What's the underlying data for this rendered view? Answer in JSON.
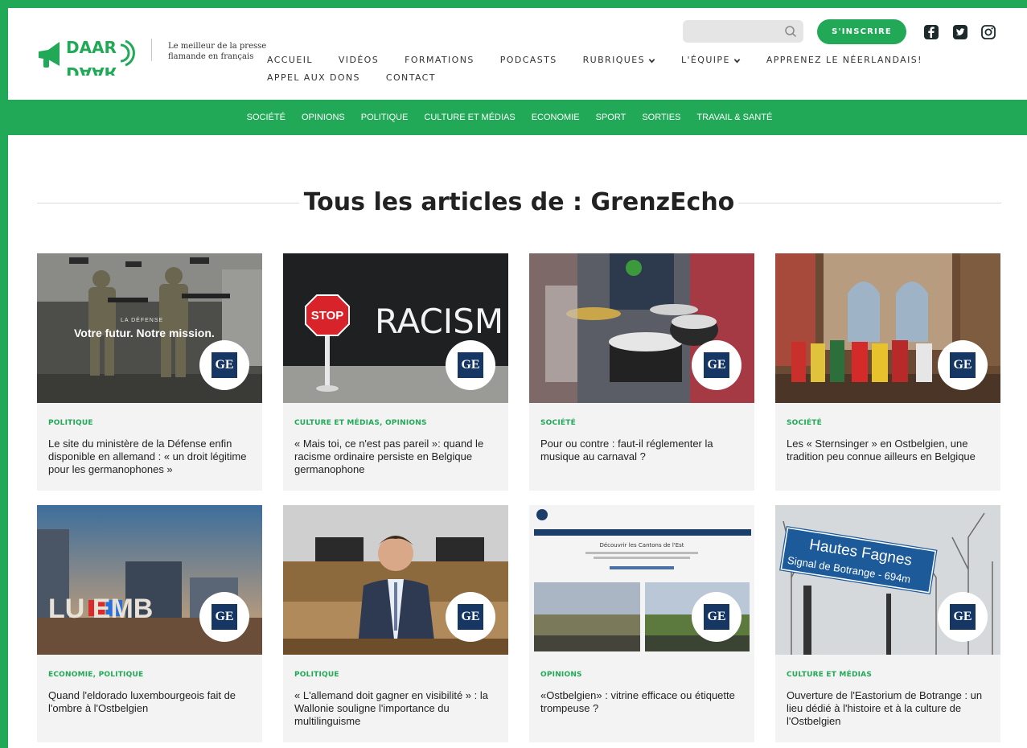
{
  "brand": {
    "logo_top": "DAAR",
    "logo_bottom": "DAAR",
    "tagline": "Le meilleur de la presse flamande en français",
    "accent_color": "#21a957",
    "badge_color": "#163664"
  },
  "header": {
    "search_placeholder": "",
    "signup_label": "S'INSCRIRE",
    "social_icons": [
      "facebook-icon",
      "twitter-icon",
      "instagram-icon"
    ]
  },
  "main_nav": [
    {
      "label": "Accueil"
    },
    {
      "label": "Vidéos"
    },
    {
      "label": "Formations"
    },
    {
      "label": "Podcasts"
    },
    {
      "label": "Rubriques",
      "dropdown": true
    },
    {
      "label": "L'équipe",
      "dropdown": true
    },
    {
      "label": "Apprenez le néerlandais!"
    },
    {
      "label": "Appel aux dons"
    },
    {
      "label": "Contact"
    }
  ],
  "category_bar": [
    "Société",
    "Opinions",
    "Politique",
    "Culture et médias",
    "Economie",
    "Sport",
    "Sorties",
    "Travail & Santé"
  ],
  "page_title": "Tous les articles de : GrenzEcho",
  "badge_label": "GE",
  "articles": [
    {
      "category": "Politique",
      "title": "Le site du ministère de la Défense enfin disponible en allemand : « un droit légitime pour les germanophones »",
      "image_text_small": "LA DÉFENSE",
      "image_text": "Votre futur. Notre mission."
    },
    {
      "category": "Culture et médias, Opinions",
      "title": "« Mais toi, ce n'est pas pareil »: quand le racisme ordinaire persiste en Belgique germanophone",
      "image_sign": "STOP",
      "image_text": "RACISM"
    },
    {
      "category": "Société",
      "title": "Pour ou contre : faut-il réglementer la musique au carnaval ?"
    },
    {
      "category": "Société",
      "title": "Les « Sternsinger » en Ostbelgien, une tradition peu connue ailleurs en Belgique"
    },
    {
      "category": "Economie, Politique",
      "title": "Quand l'eldorado luxembourgeois fait de l'ombre à l'Ostbelgien",
      "image_text": "LU  EMB"
    },
    {
      "category": "Politique",
      "title": "« L'allemand doit gagner en visibilité » : la Wallonie souligne l'importance du multilinguisme"
    },
    {
      "category": "Opinions",
      "title": "«Ostbelgien» : vitrine efficace ou étiquette trompeuse ?",
      "image_text": "Découvrir les Cantons de l'Est"
    },
    {
      "category": "Culture et médias",
      "title": "Ouverture de l'Eastorium de Botrange : un lieu dédié à l'histoire et à la culture de l'Ostbelgien",
      "image_sign_line1": "Hautes Fagnes",
      "image_sign_line2": "Signal de Botrange - 694m"
    }
  ]
}
